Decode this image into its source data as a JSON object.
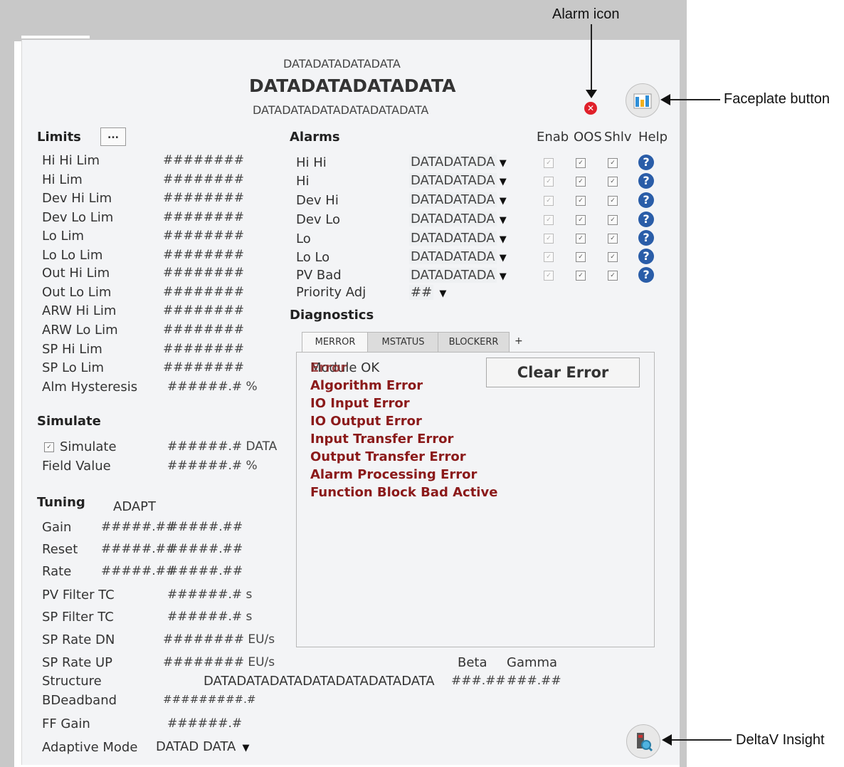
{
  "header": {
    "line1": "DATADATADATADATA",
    "line2": "DATADATADATADATA",
    "line3": "DATADATADATADATADATADATA"
  },
  "annotations": {
    "alarm_icon": "Alarm icon",
    "faceplate_button": "Faceplate button",
    "deltav_insight": "DeltaV Insight"
  },
  "limits": {
    "title": "Limits",
    "more_label": "...",
    "rows": [
      {
        "label": "Hi Hi Lim",
        "value": "########"
      },
      {
        "label": "Hi Lim",
        "value": "########"
      },
      {
        "label": "Dev Hi Lim",
        "value": "########"
      },
      {
        "label": "Dev Lo Lim",
        "value": "########"
      },
      {
        "label": "Lo Lim",
        "value": "########"
      },
      {
        "label": "Lo Lo Lim",
        "value": "########"
      },
      {
        "label": "Out Hi Lim",
        "value": "########"
      },
      {
        "label": "Out Lo Lim",
        "value": "########"
      },
      {
        "label": "ARW Hi Lim",
        "value": "########"
      },
      {
        "label": "ARW Lo Lim",
        "value": "########"
      },
      {
        "label": "SP Hi Lim",
        "value": "########"
      },
      {
        "label": "SP Lo Lim",
        "value": "########"
      },
      {
        "label": "Alm Hysteresis",
        "value": "######.# %"
      }
    ]
  },
  "simulate": {
    "title": "Simulate",
    "checkbox_label": "Simulate",
    "checkbox_value": "######.# DATA",
    "field_label": "Field Value",
    "field_value": "######.# %"
  },
  "tuning": {
    "title": "Tuning",
    "adapt": "ADAPT",
    "gain_label": "Gain",
    "gain_v1": "#####.##",
    "gain_v2": "#####.##",
    "reset_label": "Reset",
    "reset_v1": "#####.##",
    "reset_v2": "#####.##",
    "rate_label": "Rate",
    "rate_v1": "#####.##",
    "rate_v2": "#####.##",
    "pvf_label": "PV Filter TC",
    "pvf_value": "######.# s",
    "spf_label": "SP Filter TC",
    "spf_value": "######.# s",
    "spdn_label": "SP Rate DN",
    "spdn_value": "######## EU/s",
    "spup_label": "SP Rate UP",
    "spup_value": "######## EU/s",
    "beta_label": "Beta",
    "gamma_label": "Gamma",
    "structure_label": "Structure",
    "structure_value": "DATADATADATADATADATADATADATA",
    "beta_value": "###.##",
    "gamma_value": "###.##",
    "deadband_label_a": "BDeadband",
    "deadband_value": "#########.#",
    "ff_label": "FF Gain",
    "ff_value": "######.#",
    "adaptive_label": "Adaptive Mode",
    "adaptive_value": "DATAD DATA"
  },
  "alarms": {
    "title": "Alarms",
    "col_enab": "Enab",
    "col_oos": "OOS",
    "col_shlv": "Shlv",
    "col_help": "Help",
    "rows": [
      {
        "label": "Hi Hi",
        "value": "DATADATADA"
      },
      {
        "label": "Hi",
        "value": "DATADATADA"
      },
      {
        "label": "Dev Hi",
        "value": "DATADATADA"
      },
      {
        "label": "Dev Lo",
        "value": "DATADATADA"
      },
      {
        "label": "Lo",
        "value": "DATADATADA"
      },
      {
        "label": "Lo Lo",
        "value": "DATADATADA"
      },
      {
        "label": "PV Bad",
        "value": "DATADATADA"
      }
    ],
    "priority_label": "Priority Adj",
    "priority_value": "##"
  },
  "diagnostics": {
    "title": "Diagnostics",
    "tabs": [
      "MERROR",
      "MSTATUS",
      "BLOCKERR",
      "+"
    ],
    "clear_button": "Clear Error",
    "errors": [
      "Module OK",
      "Algorithm Error",
      "IO Input Error",
      "IO Output Error",
      "Input Transfer Error",
      "Output Transfer Error",
      "Alarm Processing Error",
      "Function Block Bad Active"
    ],
    "overlap_text": "Error"
  },
  "icons": {
    "alarm": "alarm-error-icon",
    "faceplate": "faceplate-chart-icon",
    "insight": "deltav-insight-icon",
    "help": "help-question-icon"
  }
}
